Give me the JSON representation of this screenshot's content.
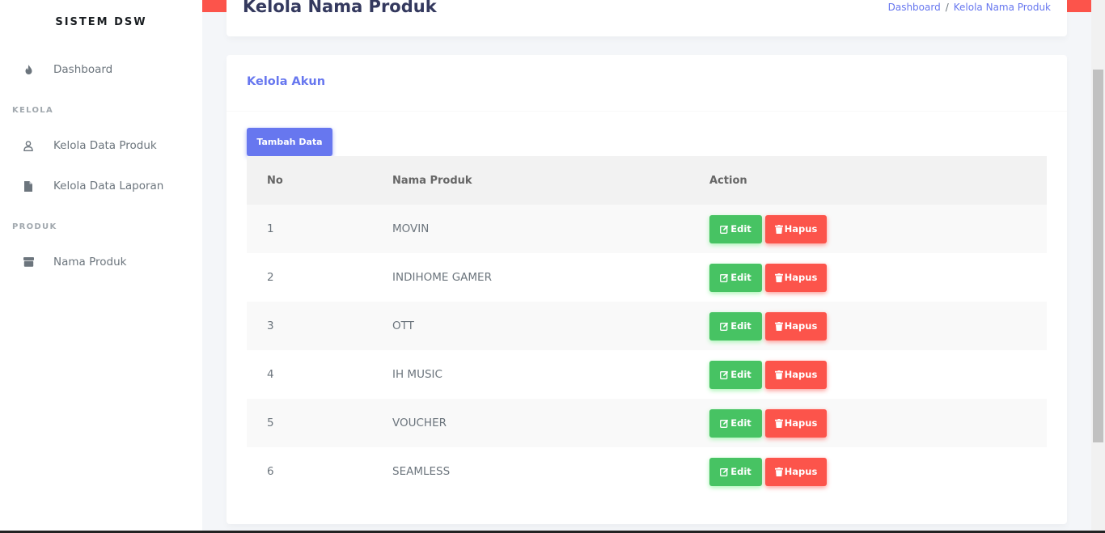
{
  "sidebar": {
    "brand": "SISTEM DSW",
    "items": [
      {
        "label": "Dashboard",
        "icon": "fire-icon"
      },
      {
        "header": "KELOLA"
      },
      {
        "label": "Kelola Data Produk",
        "icon": "user-icon"
      },
      {
        "label": "Kelola Data Laporan",
        "icon": "file-icon"
      },
      {
        "header": "PRODUK"
      },
      {
        "label": "Nama Produk",
        "icon": "box-icon"
      }
    ]
  },
  "header": {
    "title": "Kelola Nama Produk",
    "breadcrumb": [
      "Dashboard",
      "Kelola Nama Produk"
    ]
  },
  "card": {
    "title": "Kelola Akun",
    "add_button": "Tambah Data"
  },
  "table": {
    "columns": [
      "No",
      "Nama Produk",
      "Action"
    ],
    "rows": [
      {
        "no": "1",
        "name": "MOVIN"
      },
      {
        "no": "2",
        "name": "INDIHOME GAMER"
      },
      {
        "no": "3",
        "name": "OTT"
      },
      {
        "no": "4",
        "name": "IH MUSIC"
      },
      {
        "no": "5",
        "name": "VOUCHER"
      },
      {
        "no": "6",
        "name": "SEAMLESS"
      }
    ],
    "edit_label": "Edit",
    "delete_label": "Hapus"
  },
  "colors": {
    "primary": "#6777ef",
    "success": "#47c363",
    "danger": "#fc544b"
  }
}
